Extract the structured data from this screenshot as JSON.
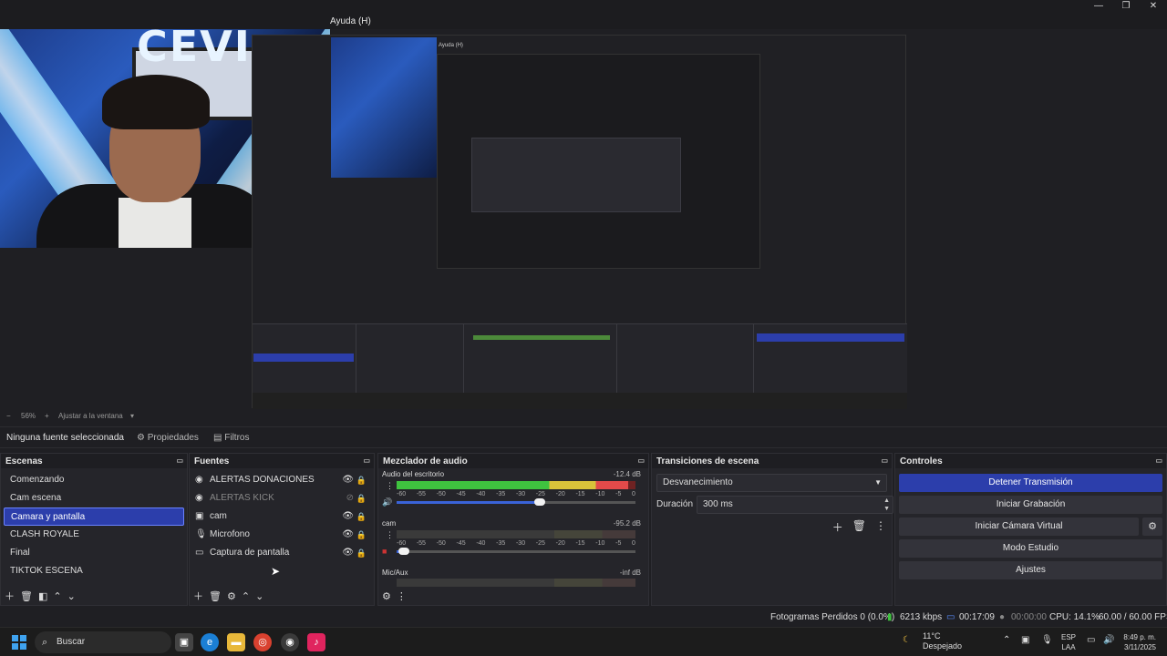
{
  "titlebar": {
    "menu_help": "Ayuda (H)",
    "controls": [
      "—",
      "❐",
      "✕"
    ]
  },
  "preview": {
    "webcam_logo": "CEVI",
    "nested_help": "Ayuda (H)"
  },
  "zoom": {
    "minus": "−",
    "value": "56%",
    "plus": "+",
    "fit": "Ajustar a la ventana",
    "caret": "▾"
  },
  "propbar": {
    "no_source": "Ninguna fuente seleccionada",
    "properties": "Propiedades",
    "filters": "Filtros"
  },
  "scenes": {
    "title": "Escenas",
    "items": [
      "Comenzando",
      "Cam escena",
      "Camara y pantalla",
      "CLASH ROYALE",
      "Final",
      "TIKTOK ESCENA"
    ],
    "selected_index": 2
  },
  "sources": {
    "title": "Fuentes",
    "items": [
      {
        "icon": "◉",
        "label": "ALERTAS DONACIONES"
      },
      {
        "icon": "◉",
        "label": "ALERTAS KICK"
      },
      {
        "icon": "▣",
        "label": "cam"
      },
      {
        "icon": "🎙",
        "label": "Microfono"
      },
      {
        "icon": "▭",
        "label": "Captura de pantalla"
      }
    ]
  },
  "mixer": {
    "title": "Mezclador de audio",
    "channels": [
      {
        "name": "Audio del escritorio",
        "db": "-12.4 dB",
        "level": 0.97,
        "volume": 0.6
      },
      {
        "name": "cam",
        "db": "-95.2 dB",
        "level": 0.0,
        "volume": 0.03
      },
      {
        "name": "Mic/Aux",
        "db": "-inf dB",
        "level": 0.0,
        "volume": 0.0
      }
    ],
    "ticks": [
      "-60",
      "-55",
      "-50",
      "-45",
      "-40",
      "-35",
      "-30",
      "-25",
      "-20",
      "-15",
      "-10",
      "-5",
      "0"
    ]
  },
  "transitions": {
    "title": "Transiciones de escena",
    "selected": "Desvanecimiento",
    "duration_label": "Duración",
    "duration_value": "300 ms"
  },
  "controls": {
    "title": "Controles",
    "stop_stream": "Detener Transmisión",
    "start_recording": "Iniciar Grabación",
    "start_virtual_cam": "Iniciar Cámara Virtual",
    "studio_mode": "Modo Estudio",
    "settings": "Ajustes"
  },
  "status": {
    "dropped_frames": "Fotogramas Perdidos 0 (0.0%)",
    "bitrate": "6213 kbps",
    "stream_time": "00:17:09",
    "rec_time": "00:00:00",
    "cpu": "CPU: 14.1%",
    "fps": "60.00 / 60.00 FPS"
  },
  "taskbar": {
    "search": "Buscar",
    "weather_temp": "11°C",
    "weather_desc": "Despejado",
    "lang_top": "ESP",
    "lang_bottom": "LAA",
    "time": "8:49 p. m.",
    "date": "3/11/2025"
  },
  "colors": {
    "accent": "#2c3eab",
    "background": "#1f1f23",
    "dock": "#25252a"
  }
}
